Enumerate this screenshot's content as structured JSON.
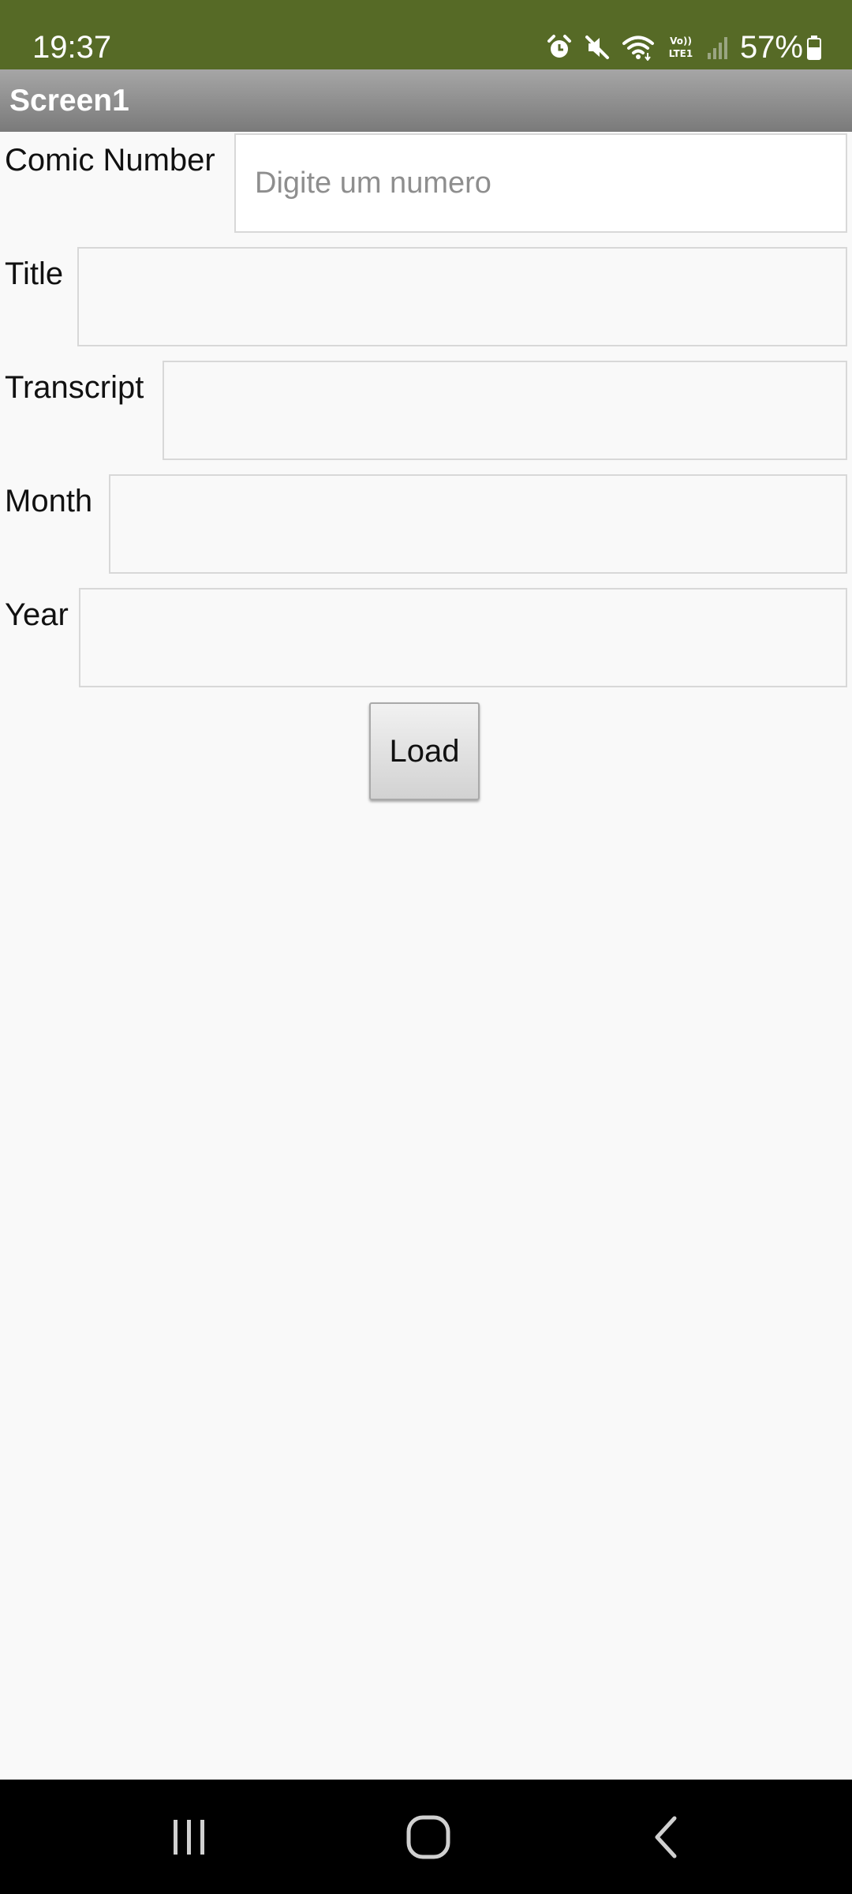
{
  "status_bar": {
    "time": "19:37",
    "battery_percent": "57%",
    "icons": [
      "alarm-icon",
      "mute-icon",
      "wifi-icon",
      "volte-lte-icon",
      "cell-signal-icon",
      "battery-icon"
    ],
    "background_color": "#566a26"
  },
  "app_bar": {
    "title": "Screen1"
  },
  "form": {
    "comic_number": {
      "label": "Comic Number",
      "placeholder": "Digite um numero",
      "value": ""
    },
    "title": {
      "label": "Title",
      "value": ""
    },
    "transcript": {
      "label": "Transcript",
      "value": ""
    },
    "month": {
      "label": "Month",
      "value": ""
    },
    "year": {
      "label": "Year",
      "value": ""
    }
  },
  "load_button": {
    "label": "Load"
  },
  "nav_bar": {
    "items": [
      "recent-apps-icon",
      "home-icon",
      "back-icon"
    ]
  }
}
